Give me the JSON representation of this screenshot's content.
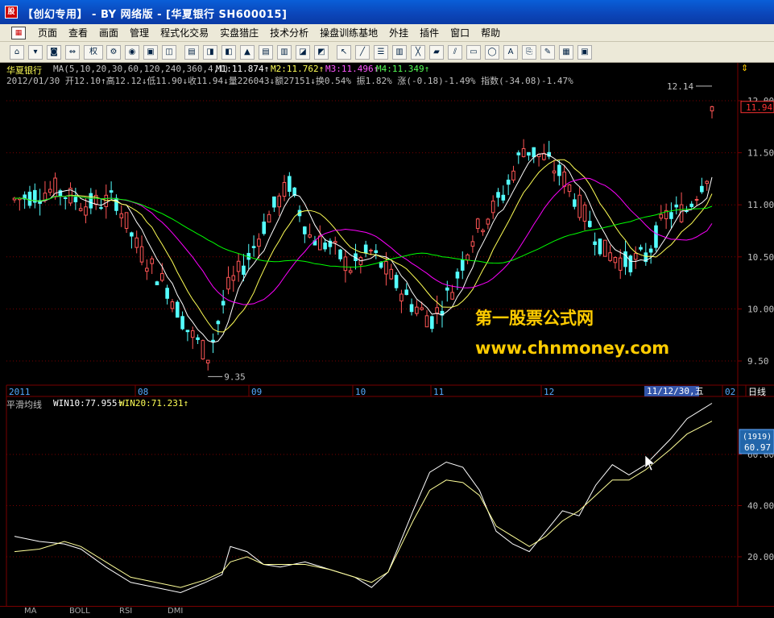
{
  "window": {
    "title": "【创幻专用】 - BY 网络版 - [华夏银行 SH600015]",
    "app_icon": "app-logo-icon"
  },
  "menubar": {
    "items": [
      "页面",
      "查看",
      "画面",
      "管理",
      "程式化交易",
      "实盘猎庄",
      "技术分析",
      "操盘训练基地",
      "外挂",
      "插件",
      "窗口",
      "帮助"
    ]
  },
  "toolbar": {
    "right_label": "权"
  },
  "main_chart": {
    "stock_label": "华夏银行",
    "ma_params": "MA(5,10,20,30,60,120,240,360,4,1)",
    "m1": "M1:11.874↑",
    "m2": "M2:11.762↑",
    "m3": "M3:11.496↑",
    "m4": "M4:11.349↑",
    "bar_info": "2012/01/30 开12.10↑高12.12↓低11.90↓收11.94↓量226043↓额27151↓换0.54% 振1.82% 涨(-0.18)-1.49% 指数(-34.08)-1.47%",
    "high_label": "12.14",
    "low_label": "9.35",
    "price_tag": "11.94",
    "y_ticks": [
      "12.00",
      "11.50",
      "11.00",
      "10.50",
      "10.00",
      "9.50"
    ],
    "x_labels": [
      "2011",
      "08",
      "09",
      "10",
      "11",
      "12",
      "02",
      "日线"
    ],
    "cursor_date": "11/12/30,五"
  },
  "sub_chart": {
    "title": "平滑均线",
    "win10": "WIN10:77.955↑",
    "win20": "WIN20:71.231↑",
    "tag1": "(1919)",
    "tag2": "60.97",
    "y_ticks": [
      "60.00",
      "40.00",
      "20.00"
    ]
  },
  "watermark": {
    "line1": "第一股票公式网",
    "line2": "www.chnmoney.com"
  },
  "bottom_tabs": [
    "MA",
    "BOLL",
    "RSI",
    "DMI"
  ],
  "colors": {
    "up": "#ff5555",
    "down": "#54ffff",
    "ma1": "#ffffff",
    "ma2": "#ffff55",
    "ma3": "#ff00ff",
    "ma4": "#00ff00",
    "grid": "#7a0000"
  }
}
